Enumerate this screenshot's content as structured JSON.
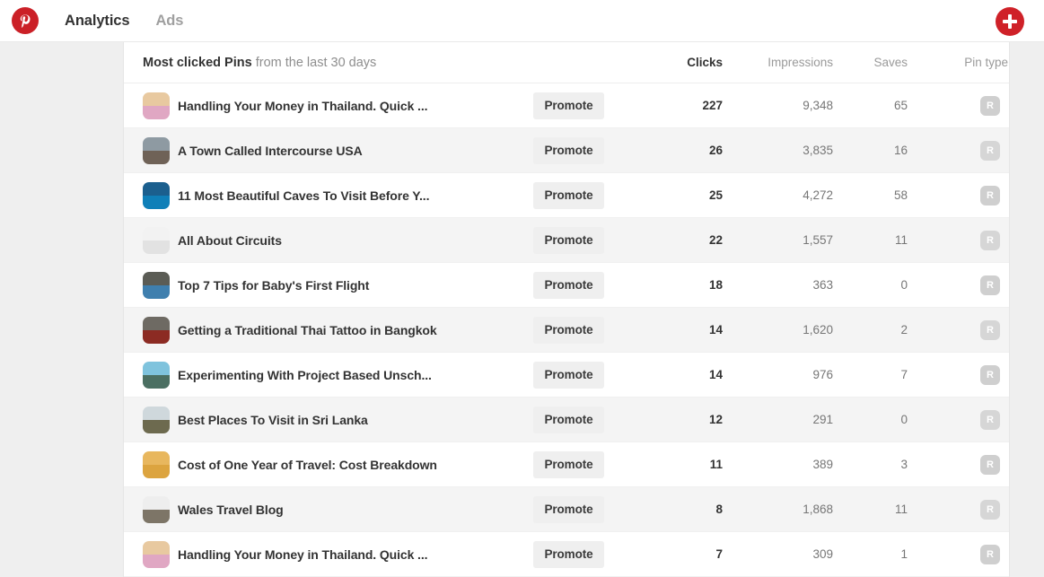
{
  "topnav": {
    "logo_icon": "pinterest-logo-icon",
    "links": [
      {
        "label": "Analytics",
        "active": true
      },
      {
        "label": "Ads",
        "active": false
      }
    ],
    "add_button": {
      "icon": "plus-icon",
      "label": ""
    },
    "accent_color": "#cb2027"
  },
  "table": {
    "title_strong": "Most clicked Pins",
    "title_light": " from the last 30 days",
    "columns": {
      "clicks": "Clicks",
      "impressions": "Impressions",
      "saves": "Saves",
      "pin_type": "Pin type"
    },
    "sorted_column": "Clicks",
    "promote_label": "Promote",
    "pin_type_badge": "R",
    "rows": [
      {
        "title": "Handling Your Money in Thailand. Quick ...",
        "clicks": "227",
        "impressions": "9,348",
        "saves": "65",
        "pin_type": "R",
        "promote": "Promote",
        "thumb": {
          "top": "#e8c9a0",
          "bottom": "#e0a7c3"
        }
      },
      {
        "title": "A Town Called Intercourse USA",
        "clicks": "26",
        "impressions": "3,835",
        "saves": "16",
        "pin_type": "R",
        "promote": "Promote",
        "thumb": {
          "top": "#8e9aa2",
          "bottom": "#6f6257"
        }
      },
      {
        "title": "11 Most Beautiful Caves To Visit Before Y...",
        "clicks": "25",
        "impressions": "4,272",
        "saves": "58",
        "pin_type": "R",
        "promote": "Promote",
        "thumb": {
          "top": "#1b5f8e",
          "bottom": "#0f7fb8"
        }
      },
      {
        "title": "All About Circuits",
        "clicks": "22",
        "impressions": "1,557",
        "saves": "11",
        "pin_type": "R",
        "promote": "Promote",
        "thumb": {
          "top": "#f2f2f2",
          "bottom": "#e2e2e2"
        }
      },
      {
        "title": "Top 7 Tips for Baby's First Flight",
        "clicks": "18",
        "impressions": "363",
        "saves": "0",
        "pin_type": "R",
        "promote": "Promote",
        "thumb": {
          "top": "#5b5c55",
          "bottom": "#3f7fae"
        }
      },
      {
        "title": "Getting a Traditional Thai Tattoo in Bangkok",
        "clicks": "14",
        "impressions": "1,620",
        "saves": "2",
        "pin_type": "R",
        "promote": "Promote",
        "thumb": {
          "top": "#6e6a63",
          "bottom": "#8c2b23"
        }
      },
      {
        "title": "Experimenting With Project Based Unsch...",
        "clicks": "14",
        "impressions": "976",
        "saves": "7",
        "pin_type": "R",
        "promote": "Promote",
        "thumb": {
          "top": "#7fc3dd",
          "bottom": "#4b6f62"
        }
      },
      {
        "title": "Best Places To Visit in Sri Lanka",
        "clicks": "12",
        "impressions": "291",
        "saves": "0",
        "pin_type": "R",
        "promote": "Promote",
        "thumb": {
          "top": "#cfd8dc",
          "bottom": "#6d6a4f"
        }
      },
      {
        "title": "Cost of One Year of Travel: Cost Breakdown",
        "clicks": "11",
        "impressions": "389",
        "saves": "3",
        "pin_type": "R",
        "promote": "Promote",
        "thumb": {
          "top": "#e8b75e",
          "bottom": "#dca43f"
        }
      },
      {
        "title": "Wales Travel Blog",
        "clicks": "8",
        "impressions": "1,868",
        "saves": "11",
        "pin_type": "R",
        "promote": "Promote",
        "thumb": {
          "top": "#eeeeee",
          "bottom": "#7d7567"
        }
      },
      {
        "title": "Handling Your Money in Thailand. Quick ...",
        "clicks": "7",
        "impressions": "309",
        "saves": "1",
        "pin_type": "R",
        "promote": "Promote",
        "thumb": {
          "top": "#e8c9a0",
          "bottom": "#e0a7c3"
        }
      }
    ]
  }
}
